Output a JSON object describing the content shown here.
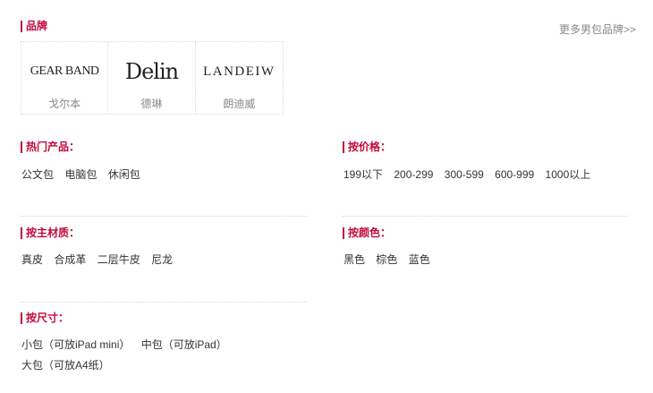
{
  "brand_section": {
    "title": "品牌",
    "more_link": "更多男包品牌>>",
    "brands": [
      {
        "logo_text": "GEAR BAND",
        "name": "戈尔本"
      },
      {
        "logo_text": "Delin",
        "name": "德琳"
      },
      {
        "logo_text": "LANDEIW",
        "name": "朗迪威"
      }
    ]
  },
  "hot_products": {
    "title": "热门产品：",
    "items": [
      "公文包",
      "电脑包",
      "休闲包"
    ]
  },
  "by_price": {
    "title": "按价格：",
    "items": [
      "199以下",
      "200-299",
      "300-599",
      "600-999",
      "1000以上"
    ]
  },
  "by_material": {
    "title": "按主材质：",
    "items": [
      "真皮",
      "合成革",
      "二层牛皮",
      "尼龙"
    ]
  },
  "by_color": {
    "title": "按颜色：",
    "items": [
      "黑色",
      "棕色",
      "蓝色"
    ]
  },
  "by_size": {
    "title": "按尺寸：",
    "items": [
      "小包（可放iPad mini）",
      "中包（可放iPad）",
      "大包（可放A4纸）"
    ]
  },
  "colors": {
    "accent": "#c3083b",
    "text": "#333333",
    "muted": "#888888"
  }
}
